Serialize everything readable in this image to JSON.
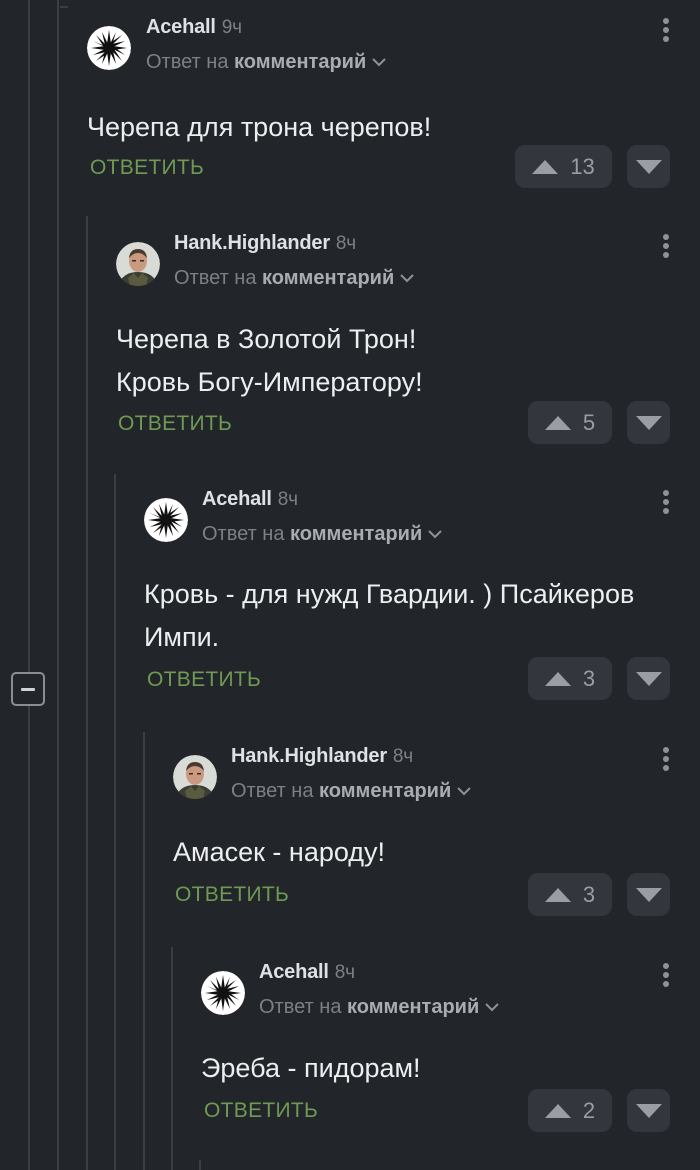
{
  "comments": [
    {
      "author": "Acehall",
      "time": "9ч",
      "reply_prefix": "Ответ на",
      "reply_target": "комментарий",
      "lines": [
        "Черепа для трона черепов!"
      ],
      "reply_label": "ОТВЕТИТЬ",
      "votes": "13",
      "avatar": "acehall"
    },
    {
      "author": "Hank.Highlander",
      "time": "8ч",
      "reply_prefix": "Ответ на",
      "reply_target": "комментарий",
      "lines": [
        "Черепа в Золотой Трон!",
        "Кровь Богу-Императору!"
      ],
      "reply_label": "ОТВЕТИТЬ",
      "votes": "5",
      "avatar": "hank"
    },
    {
      "author": "Acehall",
      "time": "8ч",
      "reply_prefix": "Ответ на",
      "reply_target": "комментарий",
      "lines": [
        "Кровь - для нужд Гвардии. ) Псайкеров",
        "Импи."
      ],
      "reply_label": "ОТВЕТИТЬ",
      "votes": "3",
      "avatar": "acehall"
    },
    {
      "author": "Hank.Highlander",
      "time": "8ч",
      "reply_prefix": "Ответ на",
      "reply_target": "комментарий",
      "lines": [
        "Амасек - народу!"
      ],
      "reply_label": "ОТВЕТИТЬ",
      "votes": "3",
      "avatar": "hank"
    },
    {
      "author": "Acehall",
      "time": "8ч",
      "reply_prefix": "Ответ на",
      "reply_target": "комментарий",
      "lines": [
        "Эреба - пидорам!"
      ],
      "reply_label": "ОТВЕТИТЬ",
      "votes": "2",
      "avatar": "acehall"
    }
  ],
  "colors": {
    "background": "#222529",
    "reply_green": "#6e9a53",
    "vote_bg": "#33373d"
  },
  "icons": [
    "collapse-thread-icon",
    "more-options-icon",
    "chevron-down-icon",
    "upvote-icon",
    "downvote-icon"
  ]
}
